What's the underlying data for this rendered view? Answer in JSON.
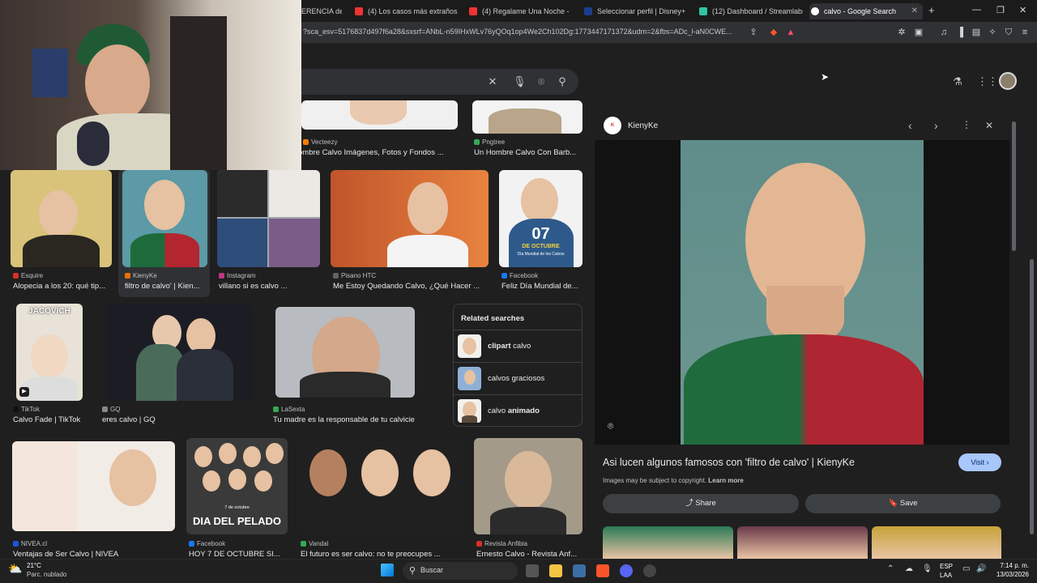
{
  "tabs": [
    {
      "label": "ERENCIA de",
      "fav": "#e33"
    },
    {
      "label": "(4) Los casos más extraños de",
      "fav": "#e33"
    },
    {
      "label": "(4) Regalame Una Noche -",
      "fav": "#e33"
    },
    {
      "label": "Seleccionar perfil | Disney+",
      "fav": "#1a3d8f"
    },
    {
      "label": "(12) Dashboard / Streamlabs",
      "fav": "#31c3a2"
    },
    {
      "label": "calvo - Google Search",
      "fav": "#4285f4"
    }
  ],
  "address": {
    "url": "?sca_esv=5176837d497f6a28&sxsrf=ANbL-n59IHxWLv76yQOq1op4We2Ch102Dg:1773447171372&udm=2&fbs=ADc_l-aN0CWE..."
  },
  "results": [
    {
      "source": "Vecteezy",
      "caption": "ombre Calvo Imágenes, Fotos y Fondos ...",
      "color": "#ff7a00"
    },
    {
      "source": "Pngtree",
      "caption": "Un Hombre Calvo Con Barb...",
      "color": "#34a853"
    },
    {
      "source": "Esquire",
      "caption": "Alopecia a los 20: qué tip...",
      "color": "#d93025"
    },
    {
      "source": "KienyKe",
      "caption": "filtro de calvo' | Kien...",
      "color": "#e8710a"
    },
    {
      "source": "Instagram",
      "caption": "villano si es calvo ...",
      "color": "#c13584"
    },
    {
      "source": "Pisano HTC",
      "caption": "Me Estoy Quedando Calvo, ¿Qué Hacer ...",
      "color": "#5f6368"
    },
    {
      "source": "Facebook",
      "caption": "Feliz Día Mundial de...",
      "color": "#1877f2"
    },
    {
      "source": "TikTok",
      "caption": "Calvo Fade | TikTok",
      "color": "#111111"
    },
    {
      "source": "GQ",
      "caption": "eres calvo | GQ",
      "color": "#888888"
    },
    {
      "source": "LaSexta",
      "caption": "Tu madre es la responsable de tu calvicie",
      "color": "#34a853"
    },
    {
      "source": "NIVEA.cl",
      "caption": "Ventajas de Ser Calvo | NIVEA",
      "color": "#1a56db"
    },
    {
      "source": "Facebook",
      "caption": "HOY 7 DE OCTUBRE SI...",
      "color": "#1877f2"
    },
    {
      "source": "Vandal",
      "caption": "El futuro es ser calvo: no te preocupes ...",
      "color": "#34a853"
    },
    {
      "source": "Revista Anfibia",
      "caption": "Ernesto Calvo - Revista Anf...",
      "color": "#d93025"
    }
  ],
  "thumb_text": {
    "calendar_num": "07",
    "calendar_month": "DE OCTUBRE",
    "calendar_sub": "Día Mundial de los Calvos",
    "tiktok": "JACOVICH",
    "pelado": "DIA DEL PELADO",
    "pelado_date": "7 de octubre"
  },
  "related": {
    "title": "Related searches",
    "items": [
      {
        "bold": "clipart",
        "rest": " calvo",
        "boldfirst": true
      },
      {
        "bold": "",
        "rest": "calvos graciosos",
        "boldfirst": true
      },
      {
        "bold": "animado",
        "rest": "calvo ",
        "boldfirst": false
      }
    ]
  },
  "panel": {
    "site": "KienyKe",
    "title": "Asi lucen algunos famosos con 'filtro de calvo' | KienyKe",
    "visit": "Visit",
    "copyright": "Images may be subject to copyright.",
    "learn": "Learn more",
    "share": "Share",
    "save": "Save"
  },
  "taskbar": {
    "temp": "21°C",
    "weather": "Parc. nublado",
    "search": "Buscar",
    "lang": "ESP",
    "lang2": "LAA",
    "time": "7:14 p. m.",
    "date": "13/03/2026"
  }
}
